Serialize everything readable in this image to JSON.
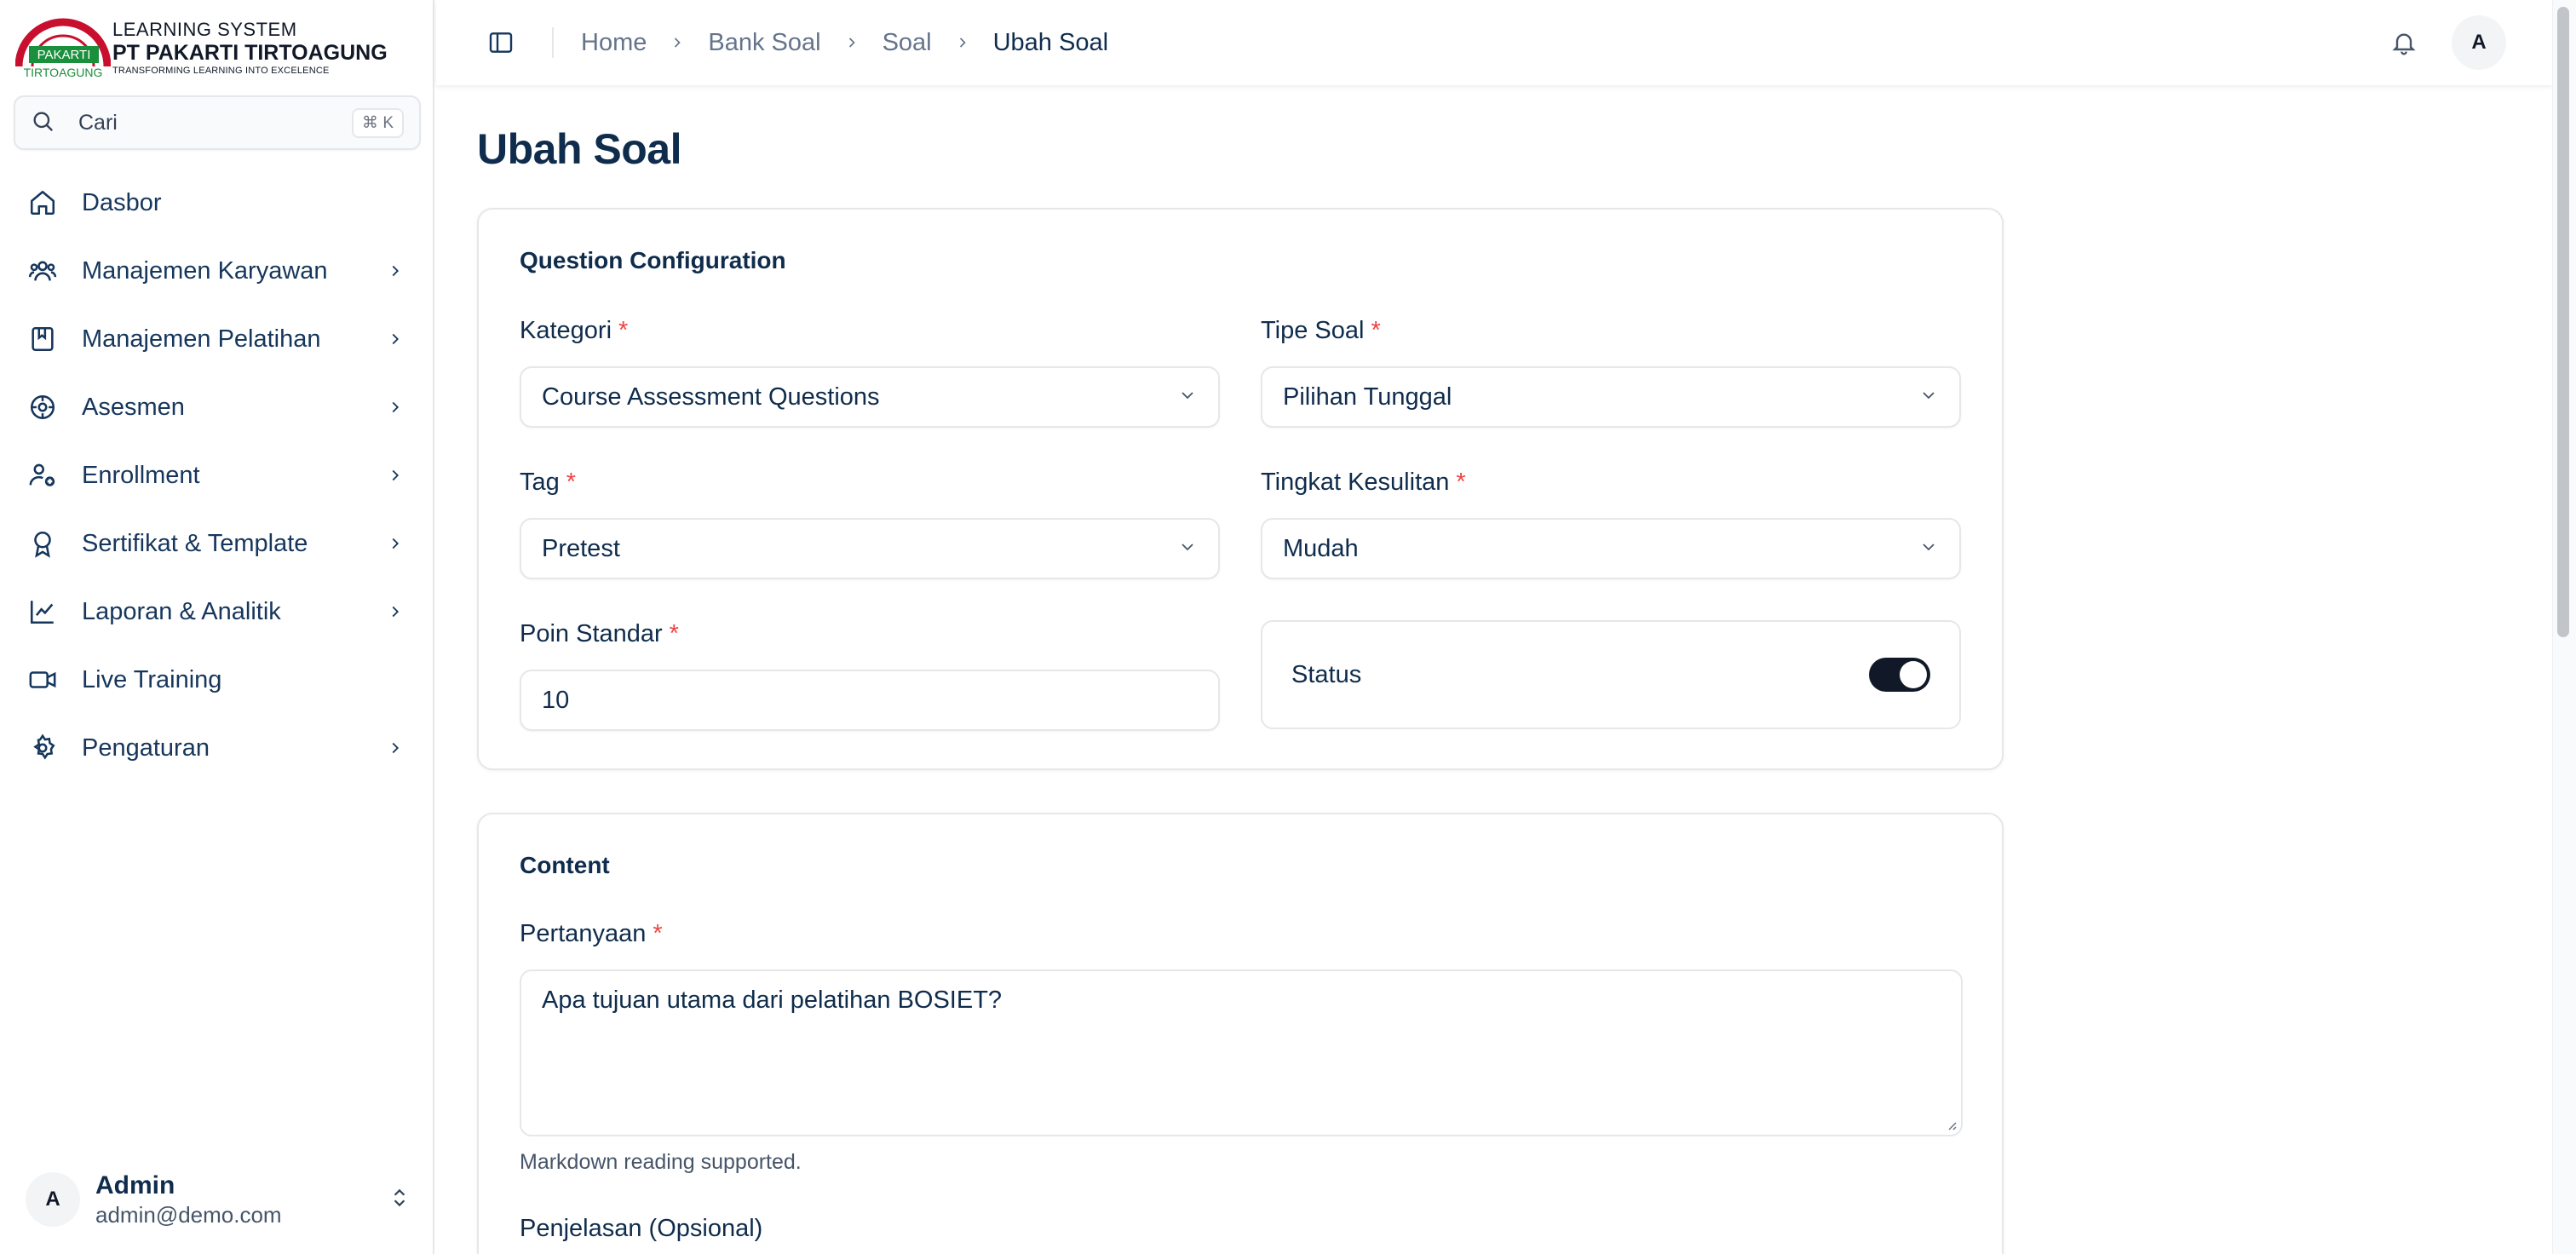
{
  "brand": {
    "logo_text": "PAKARTI",
    "logo_subtext": "TIRTOAGUNG",
    "line1": "LEARNING SYSTEM",
    "line2": "PT PAKARTI TIRTOAGUNG",
    "line3": "TRANSFORMING LEARNING INTO EXCELENCE"
  },
  "search": {
    "label": "Cari",
    "shortcut": "⌘ K"
  },
  "sidebar": {
    "items": [
      {
        "label": "Dasbor",
        "icon": "home-icon",
        "has_children": false
      },
      {
        "label": "Manajemen Karyawan",
        "icon": "users-icon",
        "has_children": true
      },
      {
        "label": "Manajemen Pelatihan",
        "icon": "book-icon",
        "has_children": true
      },
      {
        "label": "Asesmen",
        "icon": "gear-badge-icon",
        "has_children": true
      },
      {
        "label": "Enrollment",
        "icon": "user-plus-icon",
        "has_children": true
      },
      {
        "label": "Sertifikat & Template",
        "icon": "award-icon",
        "has_children": true
      },
      {
        "label": "Laporan & Analitik",
        "icon": "chart-line-icon",
        "has_children": true
      },
      {
        "label": "Live Training",
        "icon": "video-icon",
        "has_children": false
      },
      {
        "label": "Pengaturan",
        "icon": "settings-icon",
        "has_children": true
      }
    ]
  },
  "user": {
    "initial": "A",
    "name": "Admin",
    "email": "admin@demo.com"
  },
  "breadcrumbs": [
    "Home",
    "Bank Soal",
    "Soal",
    "Ubah Soal"
  ],
  "topbar": {
    "avatar_initial": "A"
  },
  "page": {
    "title": "Ubah Soal"
  },
  "config": {
    "title": "Question Configuration",
    "kategori": {
      "label": "Kategori",
      "value": "Course Assessment Questions"
    },
    "tipe": {
      "label": "Tipe Soal",
      "value": "Pilihan Tunggal"
    },
    "tag": {
      "label": "Tag",
      "value": "Pretest"
    },
    "tingkat": {
      "label": "Tingkat Kesulitan",
      "value": "Mudah"
    },
    "poin": {
      "label": "Poin Standar",
      "value": "10"
    },
    "status": {
      "label": "Status",
      "enabled": true
    },
    "required_mark": "*"
  },
  "content": {
    "title": "Content",
    "pertanyaan": {
      "label": "Pertanyaan",
      "value": "Apa tujuan utama dari pelatihan BOSIET?"
    },
    "helper": "Markdown reading supported.",
    "penjelasan": {
      "label": "Penjelasan (Opsional)"
    }
  },
  "colors": {
    "accent": "#0f2c4c",
    "required": "#ef4444",
    "logo_red": "#c8102e",
    "logo_green": "#1a8f3c"
  }
}
